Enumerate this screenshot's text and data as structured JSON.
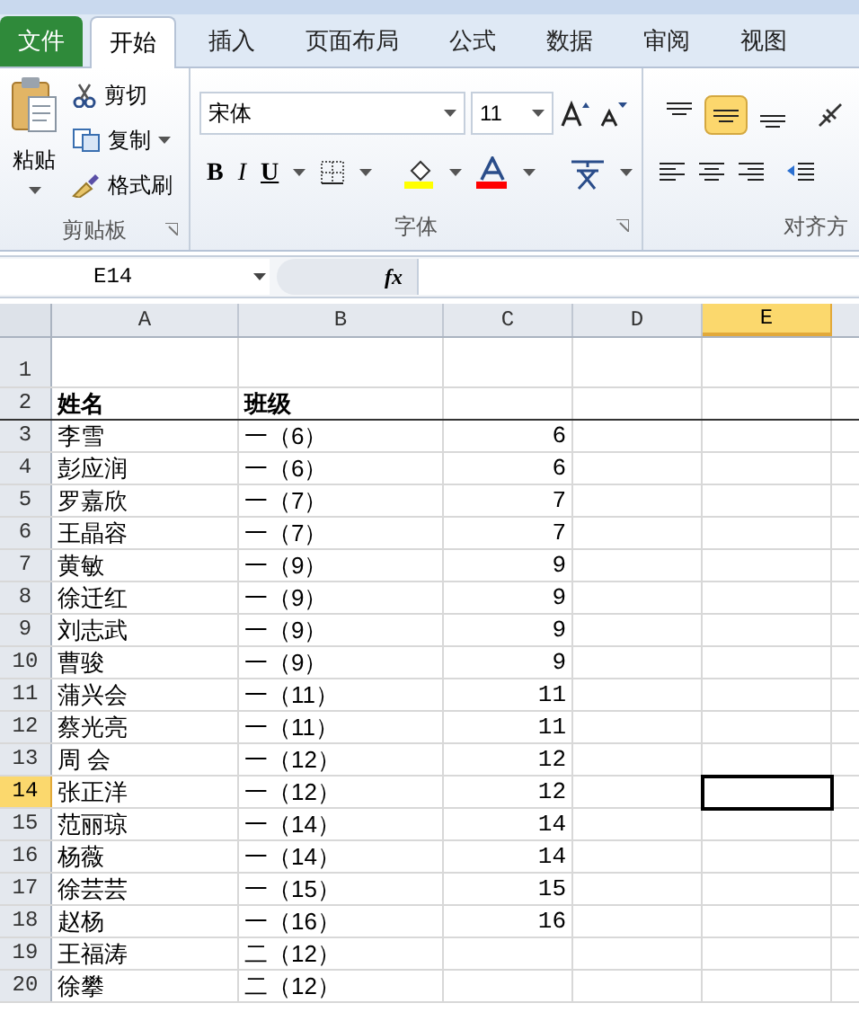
{
  "tabs": [
    {
      "label": "文件",
      "kind": "file",
      "selected": false
    },
    {
      "label": "开始",
      "kind": "tab",
      "selected": true
    },
    {
      "label": "插入",
      "kind": "tab",
      "selected": false
    },
    {
      "label": "页面布局",
      "kind": "tab",
      "selected": false
    },
    {
      "label": "公式",
      "kind": "tab",
      "selected": false
    },
    {
      "label": "数据",
      "kind": "tab",
      "selected": false
    },
    {
      "label": "审阅",
      "kind": "tab",
      "selected": false
    },
    {
      "label": "视图",
      "kind": "tab",
      "selected": false
    }
  ],
  "clipboard": {
    "paste": "粘贴",
    "cut": "剪切",
    "copy": "复制",
    "format_painter": "格式刷",
    "group_label": "剪贴板"
  },
  "font": {
    "font_name": "宋体",
    "font_size": "11",
    "bold": "B",
    "italic": "I",
    "underline": "U",
    "group_label": "字体"
  },
  "alignment": {
    "vertical": [
      {
        "kind": "top",
        "selected": false
      },
      {
        "kind": "middle",
        "selected": true
      },
      {
        "kind": "bottom",
        "selected": false
      }
    ],
    "group_label": "对齐方"
  },
  "formula_bar": {
    "name_box": "E14",
    "fx": "fx"
  },
  "columns": [
    {
      "label": "A",
      "selected": false
    },
    {
      "label": "B",
      "selected": false
    },
    {
      "label": "C",
      "selected": false
    },
    {
      "label": "D",
      "selected": false
    },
    {
      "label": "E",
      "selected": true
    }
  ],
  "rows": [
    {
      "number": "1",
      "kind": "blank",
      "selected": false
    },
    {
      "number": "2",
      "kind": "header",
      "selected": false,
      "name": "姓名",
      "class": "班级"
    },
    {
      "number": "3",
      "kind": "data",
      "selected": false,
      "name": "李雪",
      "class": "一（6）",
      "count": "6"
    },
    {
      "number": "4",
      "kind": "data",
      "selected": false,
      "name": "彭应润",
      "class": "一（6）",
      "count": "6"
    },
    {
      "number": "5",
      "kind": "data",
      "selected": false,
      "name": "罗嘉欣",
      "class": "一（7）",
      "count": "7"
    },
    {
      "number": "6",
      "kind": "data",
      "selected": false,
      "name": "王晶容",
      "class": "一（7）",
      "count": "7"
    },
    {
      "number": "7",
      "kind": "data",
      "selected": false,
      "name": "黄敏",
      "class": "一（9）",
      "count": "9"
    },
    {
      "number": "8",
      "kind": "data",
      "selected": false,
      "name": "徐迁红",
      "class": "一（9）",
      "count": "9"
    },
    {
      "number": "9",
      "kind": "data",
      "selected": false,
      "name": "刘志武",
      "class": "一（9）",
      "count": "9"
    },
    {
      "number": "10",
      "kind": "data",
      "selected": false,
      "name": "曹骏",
      "class": "一（9）",
      "count": "9"
    },
    {
      "number": "11",
      "kind": "data",
      "selected": false,
      "name": "蒲兴会",
      "class": "一（11）",
      "count": "11"
    },
    {
      "number": "12",
      "kind": "data",
      "selected": false,
      "name": "蔡光亮",
      "class": "一（11）",
      "count": "11"
    },
    {
      "number": "13",
      "kind": "data",
      "selected": false,
      "name": "周 会",
      "class": "一（12）",
      "count": "12"
    },
    {
      "number": "14",
      "kind": "data",
      "selected": true,
      "name": "张正洋",
      "class": "一（12）",
      "count": "12"
    },
    {
      "number": "15",
      "kind": "data",
      "selected": false,
      "name": "范丽琼",
      "class": "一（14）",
      "count": "14"
    },
    {
      "number": "16",
      "kind": "data",
      "selected": false,
      "name": "杨薇",
      "class": "一（14）",
      "count": "14"
    },
    {
      "number": "17",
      "kind": "data",
      "selected": false,
      "name": "徐芸芸",
      "class": "一（15）",
      "count": "15"
    },
    {
      "number": "18",
      "kind": "data",
      "selected": false,
      "name": "赵杨",
      "class": "一（16）",
      "count": "16"
    },
    {
      "number": "19",
      "kind": "data",
      "selected": false,
      "name": "王福涛",
      "class": "二（12）"
    },
    {
      "number": "20",
      "kind": "data",
      "selected": false,
      "name": "徐攀",
      "class": "二（12）"
    }
  ]
}
